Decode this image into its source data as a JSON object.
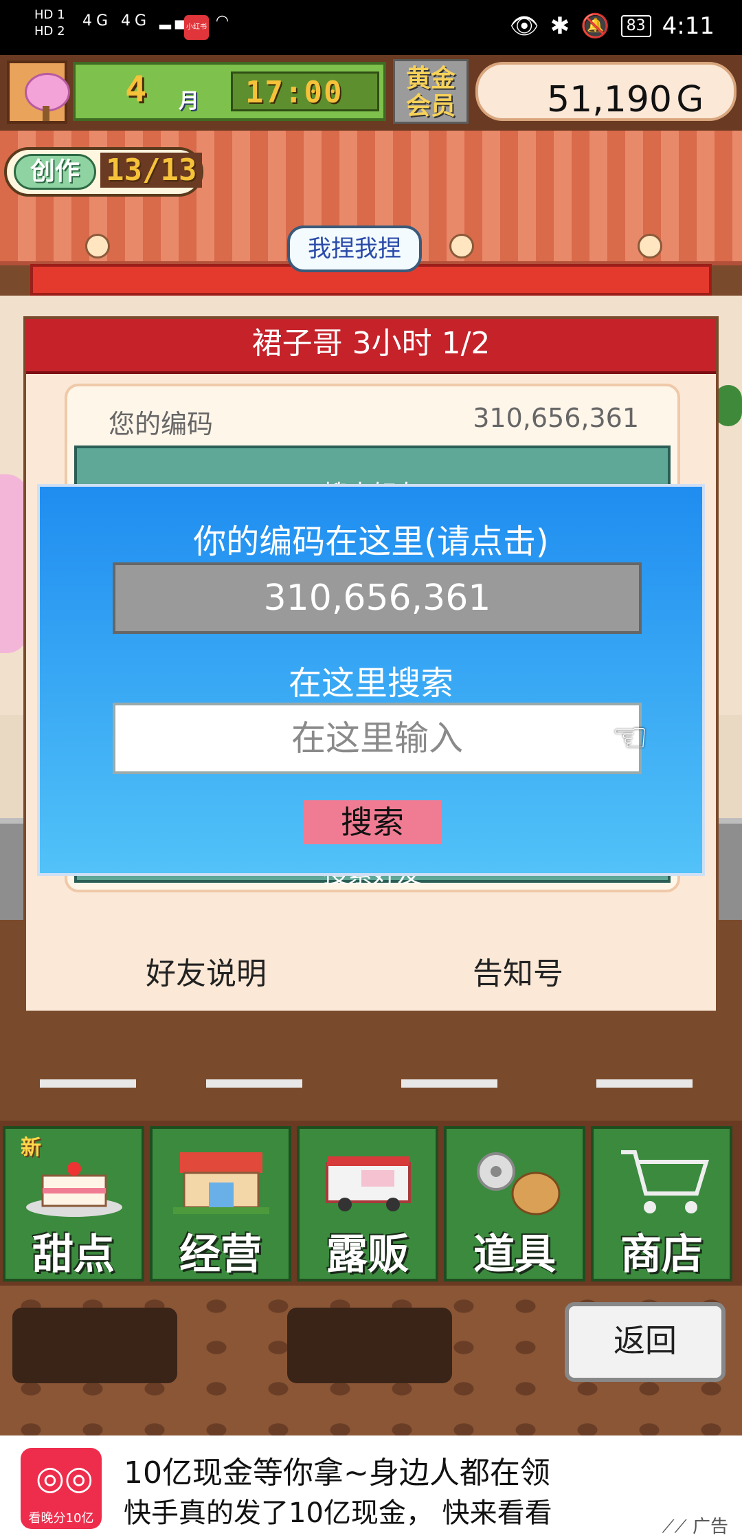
{
  "status_bar": {
    "net1": "HD 1",
    "net2": "HD 2",
    "signal": "4G 4G",
    "app_badge": "小红书",
    "battery": "83",
    "time": "4:11"
  },
  "hud": {
    "month": "4",
    "month_unit": "月",
    "time": "17:00",
    "gold_member": "黄金会员",
    "money": "51,190Ｇ"
  },
  "creation": {
    "label": "创作",
    "value": "13/13"
  },
  "speech_bubble": "我捏我捏",
  "panel": {
    "title": "裙子哥  3小时 1/2",
    "code_label": "您的编码",
    "code_value": "310,656,361",
    "search_friend_top": "搜索好友",
    "search_friend_bottom": "搜索好友",
    "friend_help": "好友说明",
    "notice": "告知号"
  },
  "dialog": {
    "title": "你的编码在这里(请点击)",
    "code": "310,656,361",
    "search_label": "在这里搜索",
    "input_placeholder": "在这里输入",
    "search_button": "搜索"
  },
  "menu": {
    "items": [
      {
        "label": "甜点",
        "badge": "新"
      },
      {
        "label": "经营"
      },
      {
        "label": "露贩"
      },
      {
        "label": "道具"
      },
      {
        "label": "商店"
      }
    ]
  },
  "bottom": {
    "back": "返回"
  },
  "ad": {
    "icon_caption": "看晚分10亿",
    "title": "10亿现金等你拿~身边人都在领",
    "subtitle": "快手真的发了10亿现金， 快来看看",
    "tag": "广告"
  }
}
